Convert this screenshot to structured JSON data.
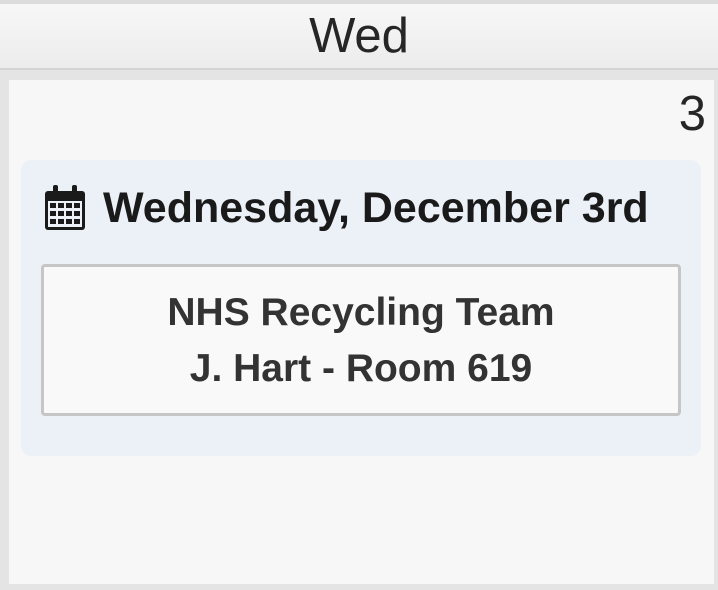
{
  "day_header": {
    "label": "Wed"
  },
  "day_cell": {
    "day_number": "3"
  },
  "event_group": {
    "date_label": "Wednesday, December 3rd",
    "icon": "calendar-icon",
    "events": [
      {
        "title": "NHS Recycling Team",
        "location": "J. Hart - Room 619"
      }
    ]
  }
}
